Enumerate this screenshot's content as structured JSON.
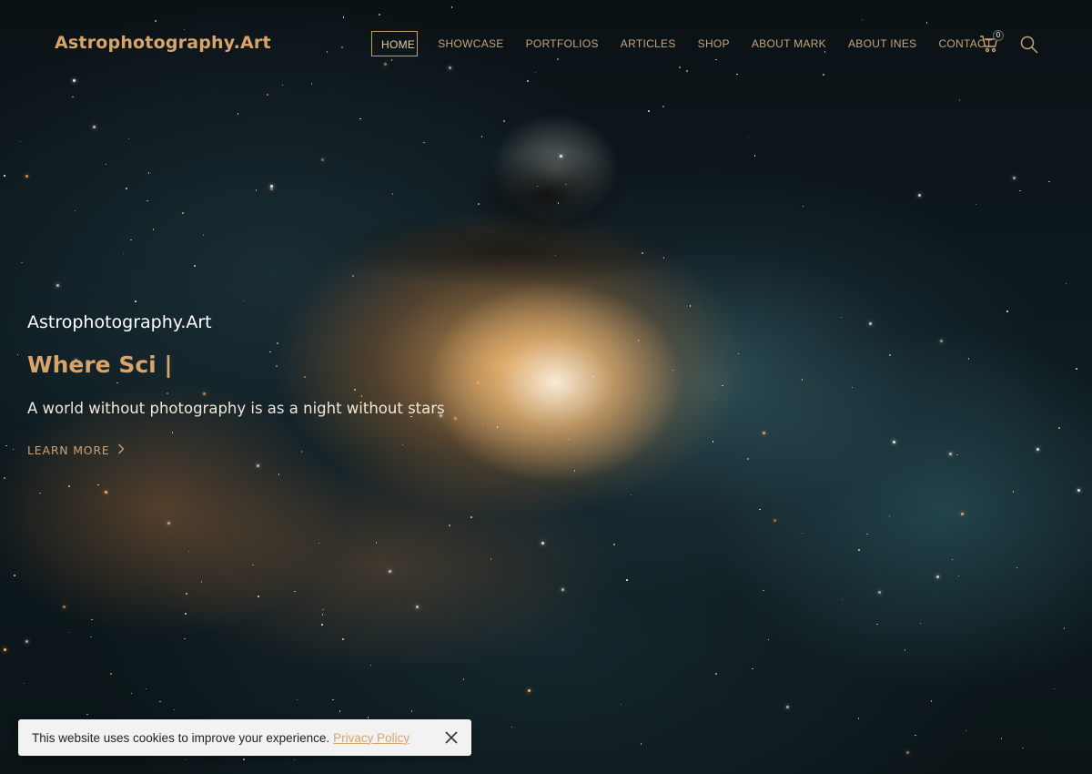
{
  "brand": {
    "logo": "Astrophotography.Art"
  },
  "nav": {
    "items": [
      {
        "label": "HOME",
        "active": true
      },
      {
        "label": "SHOWCASE"
      },
      {
        "label": "PORTFOLIOS"
      },
      {
        "label": "ARTICLES"
      },
      {
        "label": "SHOP"
      },
      {
        "label": "ABOUT MARK"
      },
      {
        "label": "ABOUT INES"
      },
      {
        "label": "CONTACT"
      }
    ],
    "cart_count": "0",
    "cart_icon": "cart-icon",
    "search_icon": "search-icon"
  },
  "hero": {
    "kicker": "Astrophotography.Art",
    "title": "Where Sci |",
    "subtitle": "A world without photography is as a night without stars",
    "cta_label": "LEARN MORE",
    "cta_icon": "chevron-right-icon"
  },
  "cookie": {
    "text": "This website uses cookies to improve your experience.",
    "link_label": "Privacy Policy",
    "close_icon": "close-icon"
  },
  "colors": {
    "accent": "#d9a46a",
    "nav_text": "#c9a27a",
    "cookie_bg": "#f2f2f2"
  }
}
